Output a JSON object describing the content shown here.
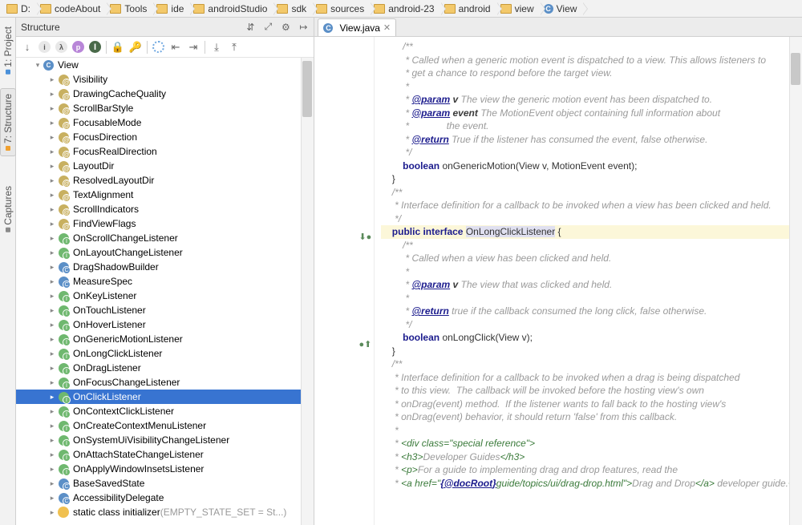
{
  "breadcrumbs": [
    {
      "label": "D:",
      "type": "folder"
    },
    {
      "label": "codeAbout",
      "type": "folder"
    },
    {
      "label": "Tools",
      "type": "folder"
    },
    {
      "label": "ide",
      "type": "folder"
    },
    {
      "label": "androidStudio",
      "type": "folder"
    },
    {
      "label": "sdk",
      "type": "folder"
    },
    {
      "label": "sources",
      "type": "folder"
    },
    {
      "label": "android-23",
      "type": "folder"
    },
    {
      "label": "android",
      "type": "folder"
    },
    {
      "label": "view",
      "type": "folder"
    },
    {
      "label": "View",
      "type": "class"
    }
  ],
  "vertical_tabs": {
    "t0": "1: Project",
    "t1": "7: Structure",
    "t2": "Captures"
  },
  "structure": {
    "title": "Structure",
    "root": "View",
    "items": [
      {
        "label": "Visibility",
        "icon": "ann"
      },
      {
        "label": "DrawingCacheQuality",
        "icon": "ann"
      },
      {
        "label": "ScrollBarStyle",
        "icon": "ann"
      },
      {
        "label": "FocusableMode",
        "icon": "ann"
      },
      {
        "label": "FocusDirection",
        "icon": "ann"
      },
      {
        "label": "FocusRealDirection",
        "icon": "ann"
      },
      {
        "label": "LayoutDir",
        "icon": "ann"
      },
      {
        "label": "ResolvedLayoutDir",
        "icon": "ann"
      },
      {
        "label": "TextAlignment",
        "icon": "ann"
      },
      {
        "label": "ScrollIndicators",
        "icon": "ann"
      },
      {
        "label": "FindViewFlags",
        "icon": "ann"
      },
      {
        "label": "OnScrollChangeListener",
        "icon": "iface"
      },
      {
        "label": "OnLayoutChangeListener",
        "icon": "iface"
      },
      {
        "label": "DragShadowBuilder",
        "icon": "cls"
      },
      {
        "label": "MeasureSpec",
        "icon": "cls"
      },
      {
        "label": "OnKeyListener",
        "icon": "iface"
      },
      {
        "label": "OnTouchListener",
        "icon": "iface"
      },
      {
        "label": "OnHoverListener",
        "icon": "iface"
      },
      {
        "label": "OnGenericMotionListener",
        "icon": "iface"
      },
      {
        "label": "OnLongClickListener",
        "icon": "iface"
      },
      {
        "label": "OnDragListener",
        "icon": "iface"
      },
      {
        "label": "OnFocusChangeListener",
        "icon": "iface"
      },
      {
        "label": "OnClickListener",
        "icon": "iface",
        "selected": true
      },
      {
        "label": "OnContextClickListener",
        "icon": "iface"
      },
      {
        "label": "OnCreateContextMenuListener",
        "icon": "iface"
      },
      {
        "label": "OnSystemUiVisibilityChangeListener",
        "icon": "iface"
      },
      {
        "label": "OnAttachStateChangeListener",
        "icon": "iface"
      },
      {
        "label": "OnApplyWindowInsetsListener",
        "icon": "iface"
      },
      {
        "label": "BaseSavedState",
        "icon": "cls"
      },
      {
        "label": "AccessibilityDelegate",
        "icon": "cls"
      },
      {
        "label": "static class initializer",
        "icon": "static",
        "suffix": "(EMPTY_STATE_SET = St...)"
      }
    ]
  },
  "editor": {
    "tab_label": "View.java",
    "code": {
      "c0": "        /**",
      "c1": "         * Called when a generic motion event is dispatched to a view. This allows listeners to",
      "c2": "         * get a chance to respond before the target view.",
      "c3": "         *",
      "c4_a": "         * ",
      "c4_b": "@param",
      "c4_c": " v ",
      "c4_d": "The view the generic motion event has been dispatched to.",
      "c5_a": "         * ",
      "c5_b": "@param",
      "c5_c": " event ",
      "c5_d": "The MotionEvent object containing full information about",
      "c6": "         *              the event.",
      "c7_a": "         * ",
      "c7_b": "@return",
      "c7_c": " True if the listener has consumed the event, false otherwise.",
      "c8": "         */",
      "c9_a": "        ",
      "c9_b": "boolean ",
      "c9_c": "onGenericMotion(View v, MotionEvent event);",
      "c10": "    }",
      "c11": "",
      "c12": "    /**",
      "c13": "     * Interface definition for a callback to be invoked when a view has been clicked and held.",
      "c14": "     */",
      "c15_a": "    ",
      "c15_b": "public interface ",
      "c15_c": "OnLongClickListener",
      "c15_d": " {",
      "c16": "        /**",
      "c17": "         * Called when a view has been clicked and held.",
      "c18": "         *",
      "c19_a": "         * ",
      "c19_b": "@param",
      "c19_c": " v ",
      "c19_d": "The view that was clicked and held.",
      "c20": "         *",
      "c21_a": "         * ",
      "c21_b": "@return",
      "c21_c": " true if the callback consumed the long click, false otherwise.",
      "c22": "         */",
      "c23_a": "        ",
      "c23_b": "boolean ",
      "c23_c": "onLongClick(View v);",
      "c24": "    }",
      "c25": "",
      "c26": "    /**",
      "c27": "     * Interface definition for a callback to be invoked when a drag is being dispatched",
      "c28": "     * to this view.  The callback will be invoked before the hosting view's own",
      "c29": "     * onDrag(event) method.  If the listener wants to fall back to the hosting view's",
      "c30": "     * onDrag(event) behavior, it should return 'false' from this callback.",
      "c31": "     *",
      "c32_a": "     * ",
      "c32_b": "<div class=\"special reference\">",
      "c33_a": "     * ",
      "c33_b": "<h3>",
      "c33_c": "Developer Guides",
      "c33_d": "</h3>",
      "c34_a": "     * ",
      "c34_b": "<p>",
      "c34_c": "For a guide to implementing drag and drop features, read the",
      "c35_a": "     * ",
      "c35_b": "<a href=\"",
      "c35_c": "{@docRoot}",
      "c35_d": "guide/topics/ui/drag-drop.html\">",
      "c35_e": "Drag and Drop",
      "c35_f": "</a>",
      "c35_g": " developer guide.",
      "c35_h": "</p"
    }
  }
}
